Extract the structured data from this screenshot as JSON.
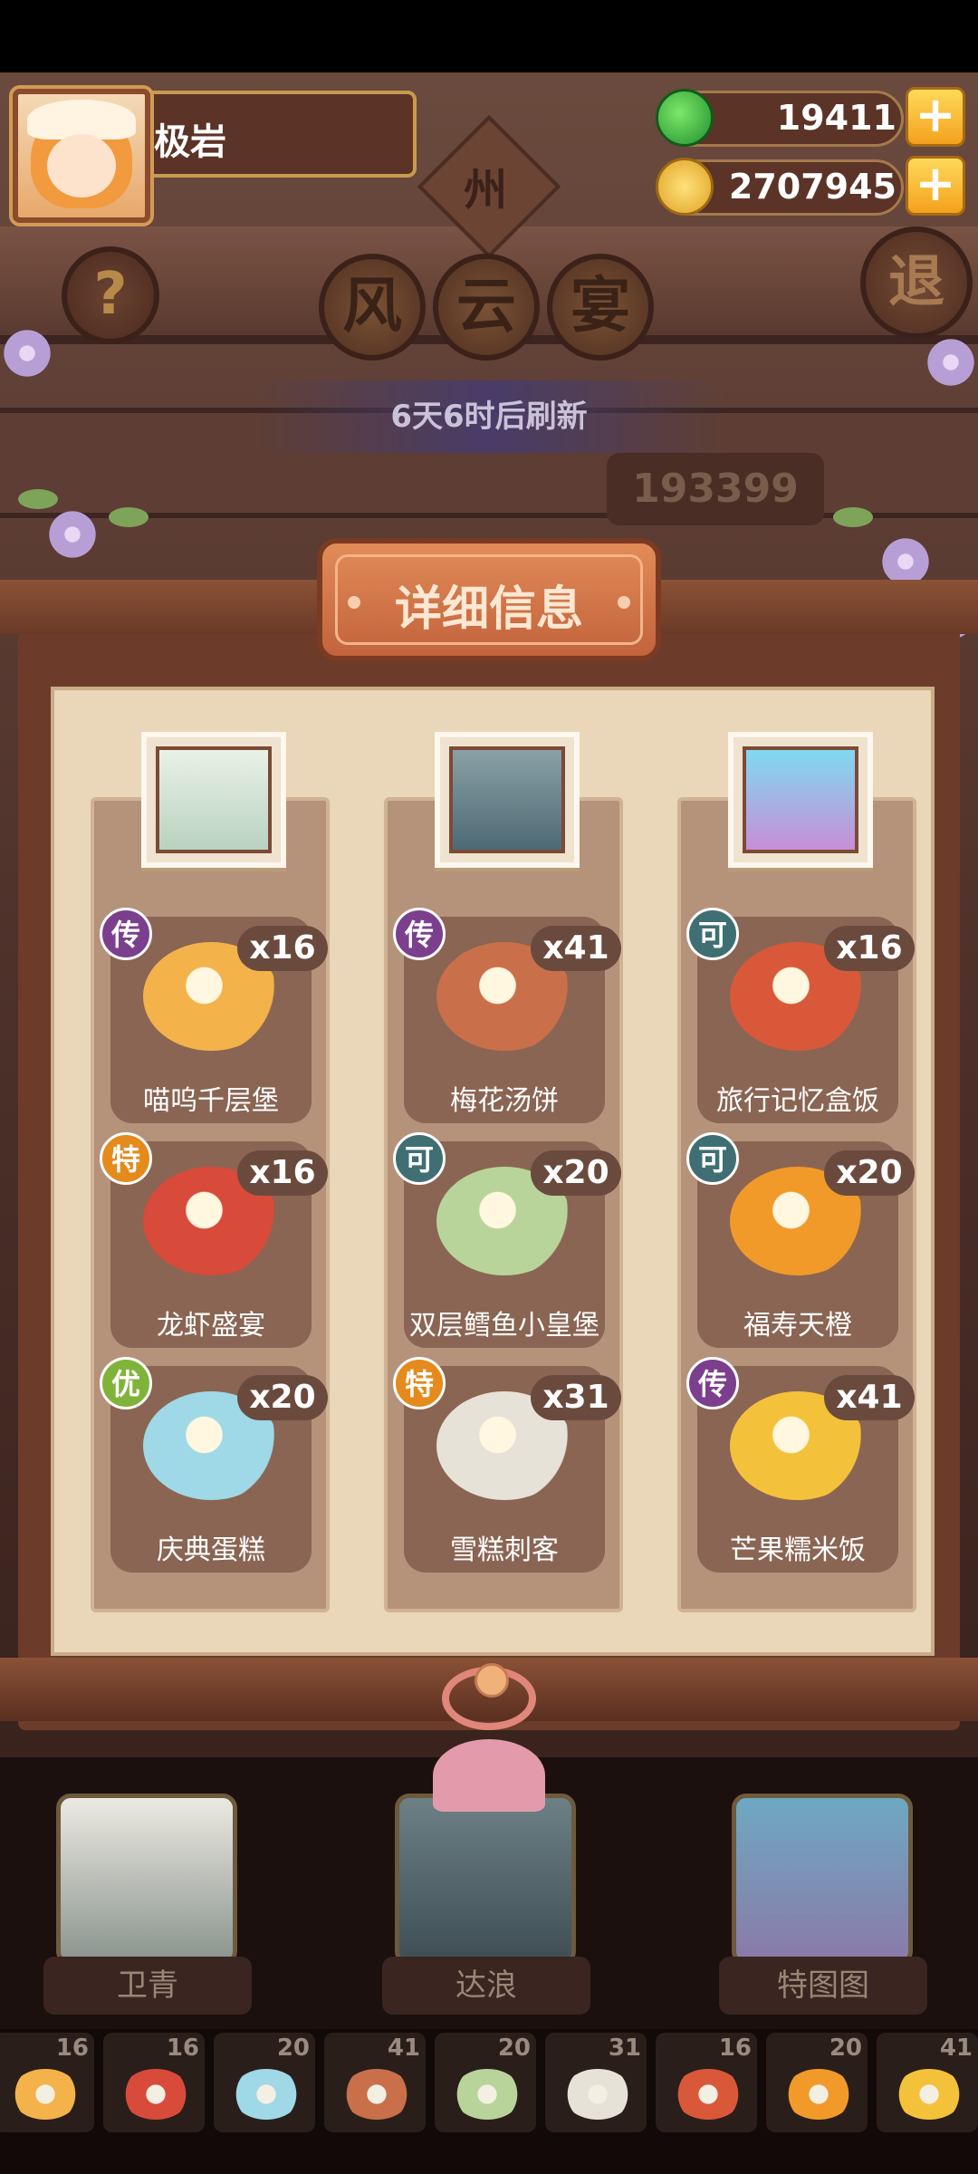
{
  "player": {
    "name": "极岩"
  },
  "currency": {
    "jade": "19411",
    "coins": "2707945",
    "add_symbol": "+"
  },
  "province_badge": "州",
  "help_symbol": "?",
  "exit_label": "退",
  "event_title": [
    "风",
    "云",
    "宴"
  ],
  "refresh_text": "6天6时后刷新",
  "score_partial": "193399",
  "panel_title": "详细信息",
  "columns": [
    {
      "dishes": [
        {
          "grade": "传",
          "qty": "x16",
          "name": "喵呜千层堡"
        },
        {
          "grade": "特",
          "qty": "x16",
          "name": "龙虾盛宴"
        },
        {
          "grade": "优",
          "qty": "x20",
          "name": "庆典蛋糕"
        }
      ]
    },
    {
      "dishes": [
        {
          "grade": "传",
          "qty": "x41",
          "name": "梅花汤饼"
        },
        {
          "grade": "可",
          "qty": "x20",
          "name": "双层鳕鱼小皇堡"
        },
        {
          "grade": "特",
          "qty": "x31",
          "name": "雪糕刺客"
        }
      ]
    },
    {
      "dishes": [
        {
          "grade": "可",
          "qty": "x16",
          "name": "旅行记忆盒饭"
        },
        {
          "grade": "可",
          "qty": "x20",
          "name": "福寿天橙"
        },
        {
          "grade": "传",
          "qty": "x41",
          "name": "芒果糯米饭"
        }
      ]
    }
  ],
  "characters": [
    {
      "name": "卫青"
    },
    {
      "name": "达浪"
    },
    {
      "name": "特图图"
    }
  ],
  "tray": [
    "16",
    "16",
    "20",
    "41",
    "20",
    "31",
    "16",
    "20",
    "41"
  ],
  "grade_colors": {
    "传": "#7b3f8e",
    "特": "#e58a1c",
    "优": "#7fb33a",
    "可": "#3f6f73"
  }
}
